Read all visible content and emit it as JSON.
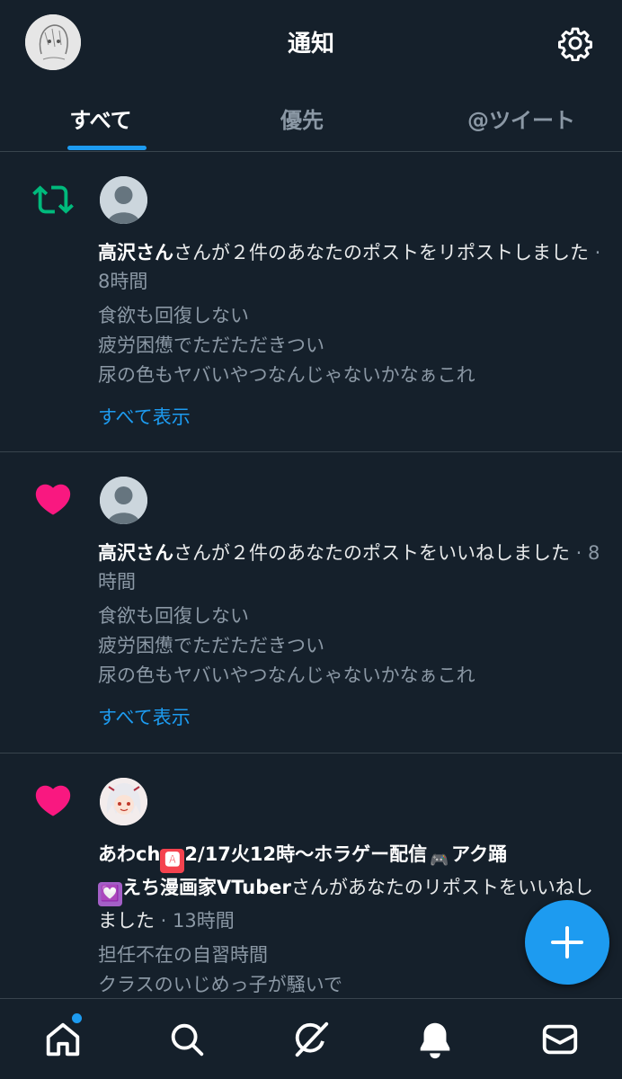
{
  "header": {
    "title": "通知",
    "avatar_icon": "user-avatar-drawing",
    "settings_icon": "gear-icon"
  },
  "tabs": [
    {
      "label": "すべて",
      "active": true
    },
    {
      "label": "優先",
      "active": false
    },
    {
      "label": "@ツイート",
      "active": false
    }
  ],
  "notifications": [
    {
      "type": "repost",
      "icon": "repost-icon",
      "icon_color": "#00ba7c",
      "user": "高沢さん",
      "action": "さんが２件のあなたのポストをリポストしました",
      "time": "8時間",
      "lines": [
        "食欲も回復しない",
        "疲労困憊でただただきつい",
        "尿の色もヤバいやつなんじゃないかなぁこれ"
      ],
      "show_all": "すべて表示"
    },
    {
      "type": "like",
      "icon": "heart-icon",
      "icon_color": "#f91880",
      "user": "高沢さん",
      "action": "さんが２件のあなたのポストをいいねしました",
      "time": "8時間",
      "lines": [
        "食欲も回復しない",
        "疲労困憊でただただきつい",
        "尿の色もヤバいやつなんじゃないかなぁこれ"
      ],
      "show_all": "すべて表示"
    },
    {
      "type": "like",
      "icon": "heart-icon",
      "icon_color": "#f91880",
      "user_parts": {
        "p1": "あわch",
        "emoji1": "🅰",
        "p2": "2/17火12時〜ホラゲー配信",
        "emoji2": "🎮",
        "p3": "アク踊",
        "emoji3": "💟",
        "p4": "えち漫画家VTuber"
      },
      "action": "さんがあなたのリポストをいいねしました",
      "time": "13時間",
      "lines": [
        "担任不在の自習時間",
        "クラスのいじめっ子が騒いで"
      ]
    }
  ],
  "fab": {
    "icon": "plus-icon"
  },
  "bottom_nav": [
    {
      "name": "home",
      "icon": "home-icon",
      "has_badge": true
    },
    {
      "name": "search",
      "icon": "search-icon"
    },
    {
      "name": "grok",
      "icon": "grok-icon"
    },
    {
      "name": "notifications",
      "icon": "bell-icon",
      "active": true
    },
    {
      "name": "messages",
      "icon": "mail-icon"
    }
  ]
}
